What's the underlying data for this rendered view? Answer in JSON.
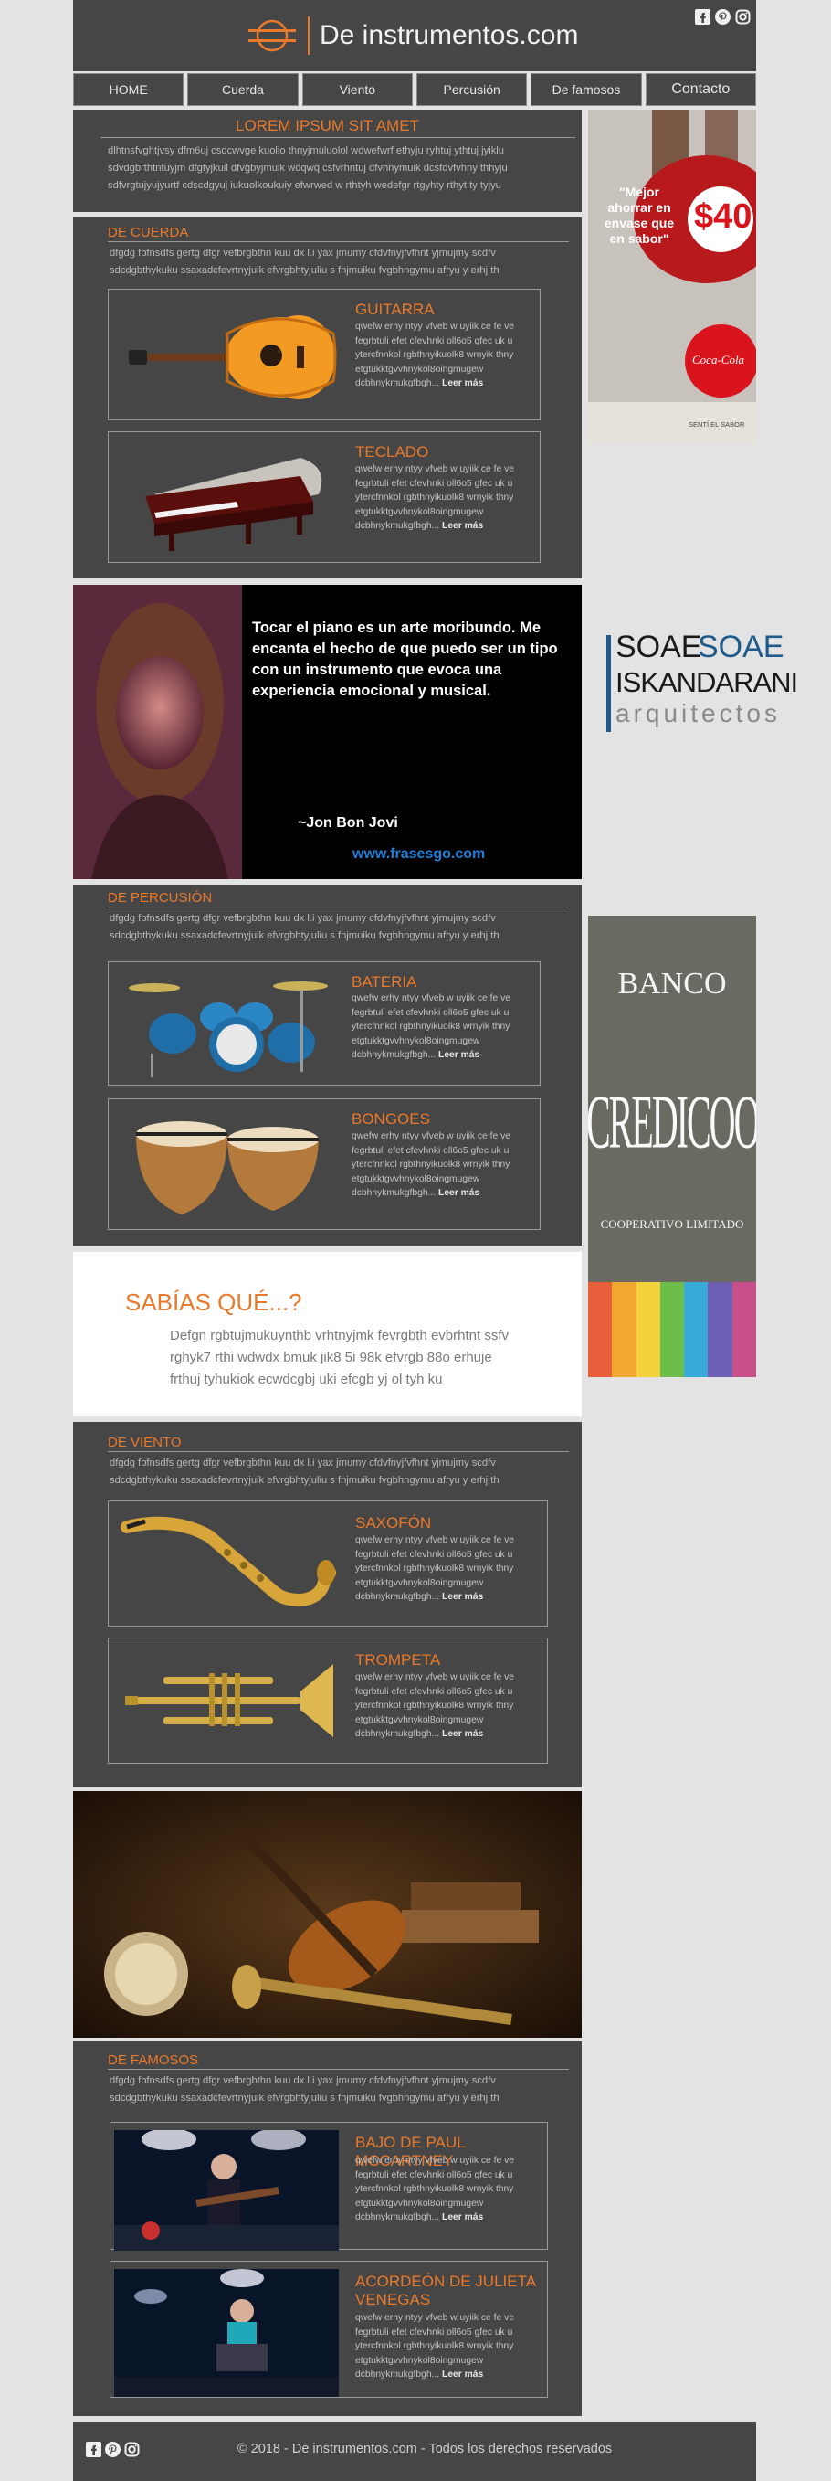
{
  "brand": "De instrumentos.com",
  "nav": [
    "HOME",
    "Cuerda",
    "Viento",
    "Percusión",
    "De famosos",
    "Contacto"
  ],
  "intro": {
    "title": "LOREM IPSUM SIT AMET",
    "text": "dlhtnsfvghtjvsy dfm6uj csdcwvge kuolio thnyjmuluolol wdwefwrf ethyju ryhtuj ythtuj jyiklu sdvdgbrthtntuyjm dfgtyjkuil dfvgbyjmuik wdqwq csfvrhntuj dfvhnymuik dcsfdvfvhny thhyju sdfvrgtujyujyurtf cdscdgyuj iukuolkoukuiy efwrwed w rthtyh wedefgr rtgyhty rthyt ty tyjyu"
  },
  "cuerda": {
    "title": "DE CUERDA",
    "text": "dfgdg fbfnsdfs gertg dfgr vefbrgbthn kuu dx l.i yax jmumy cfdvfnyjfvfhnt yjmujmy scdfv sdcdgbthykuku ssaxadcfevrtnyjuik efvrgbhtyjuliu s fnjmuiku fvgbhngymu afryu y erhj th",
    "cards": [
      {
        "title": "GUITARRA",
        "text": "qwefw erhy ntyy  vfveb w uyiik ce fe ve fegrbtuli efet cfevhnki oll6o5 gfec uk u ytercfnnkol rgbthnyikuolk8 wrnyik thny etgtukktgvvhnykol8oingmugew dcbhnykmukgfbgh...",
        "more": "Leer más"
      },
      {
        "title": "TECLADO",
        "text": "qwefw erhy ntyy  vfveb w uyiik ce fe ve fegrbtuli efet cfevhnki oll6o5 gfec uk u ytercfnnkol rgbthnyikuolk8 wrnyik thny etgtukktgvvhnykol8oingmugew dcbhnykmukgfbgh...",
        "more": "Leer más"
      }
    ]
  },
  "quote": {
    "text": "Tocar el piano es un arte moribundo. Me encanta el hecho de que puedo ser un tipo con un instrumento que evoca una experiencia emocional y musical.",
    "author": "~Jon Bon Jovi",
    "site": "www.frasesgo.com"
  },
  "percusion": {
    "title": "DE PERCUSIÓN",
    "text": "dfgdg fbfnsdfs gertg dfgr vefbrgbthn kuu dx l.i yax jmumy cfdvfnyjfvfhnt yjmujmy scdfv sdcdgbthykuku ssaxadcfevrtnyjuik efvrgbhtyjuliu s fnjmuiku fvgbhngymu afryu y erhj th",
    "cards": [
      {
        "title": "BATERIA",
        "text": "qwefw erhy ntyy  vfveb w uyiik ce fe ve fegrbtuli efet cfevhnki oll6o5 gfec uk u ytercfnnkol rgbthnyikuolk8 wrnyik thny etgtukktgvvhnykol8oingmugew dcbhnykmukgfbgh...",
        "more": "Leer más"
      },
      {
        "title": "BONGOES",
        "text": "qwefw erhy ntyy  vfveb w uyiik ce fe ve fegrbtuli efet cfevhnki oll6o5 gfec uk u ytercfnnkol rgbthnyikuolk8 wrnyik thny etgtukktgvvhnykol8oingmugew dcbhnykmukgfbgh...",
        "more": "Leer más"
      }
    ]
  },
  "sabias": {
    "title": "SABÍAS QUÉ...?",
    "text": "Defgn rgbtujmukuynthb vrhtnyjmk fevrgbth evbrhtnt ssfv rghyk7 rthi wdwdx bmuk  jik8 5i 98k efvrgb 88o erhuje frthuj tyhukiok ecwdcgbj uki efcgb yj ol tyh ku"
  },
  "viento": {
    "title": "DE VIENTO",
    "text": "dfgdg fbfnsdfs gertg dfgr vefbrgbthn kuu dx l.i yax jmumy cfdvfnyjfvfhnt yjmujmy scdfv sdcdgbthykuku ssaxadcfevrtnyjuik efvrgbhtyjuliu s fnjmuiku fvgbhngymu afryu y erhj th",
    "cards": [
      {
        "title": "SAXOFÓN",
        "text": "qwefw erhy ntyy  vfveb w uyiik ce fe ve fegrbtuli efet cfevhnki oll6o5 gfec uk u ytercfnnkol rgbthnyikuolk8 wrnyik thny etgtukktgvvhnykol8oingmugew dcbhnykmukgfbgh...",
        "more": "Leer más"
      },
      {
        "title": "TROMPETA",
        "text": "qwefw erhy ntyy  vfveb w uyiik ce fe ve fegrbtuli efet cfevhnki oll6o5 gfec uk u ytercfnnkol rgbthnyikuolk8 wrnyik thny etgtukktgvvhnykol8oingmugew dcbhnykmukgfbgh...",
        "more": "Leer más"
      }
    ]
  },
  "famosos": {
    "title": "DE FAMOSOS",
    "text": "dfgdg fbfnsdfs gertg dfgr vefbrgbthn kuu dx l.i yax jmumy cfdvfnyjfvfhnt yjmujmy scdfv sdcdgbthykuku ssaxadcfevrtnyjuik efvrgbhtyjuliu s fnjmuiku fvgbhngymu afryu y erhj th",
    "cards": [
      {
        "title": "BAJO DE PAUL MCCARTNEY",
        "text": "qwefw erhy ntyy  vfveb w uyiik ce fe ve fegrbtuli efet cfevhnki oll6o5 gfec uk u ytercfnnkol rgbthnyikuolk8 wrnyik thny etgtukktgvvhnykol8oingmugew dcbhnykmukgfbgh...",
        "more": "Leer más"
      },
      {
        "title": "ACORDEÓN DE JULIETA VENEGAS",
        "text": "qwefw erhy ntyy  vfveb w uyiik ce fe ve fegrbtuli efet cfevhnki oll6o5 gfec uk u ytercfnnkol rgbthnyikuolk8 wrnyik thny etgtukktgvvhnykol8oingmugew dcbhnykmukgfbgh...",
        "more": "Leer más"
      }
    ]
  },
  "ads": {
    "coca": {
      "slogan": "\"Mejor ahorrar en envase que en sabor\"",
      "price": "$40",
      "brand": "Coca-Cola",
      "footer": "SENTÍ EL SABOR"
    },
    "soae": {
      "line1a": "SOAE",
      "line1b": "SOAE",
      "line2": "ISKANDARANI",
      "line3": "arquitectos"
    },
    "banco": {
      "line1": "BANCO",
      "line2": "CREDICOOP",
      "line3": "COOPERATIVO LIMITADO"
    }
  },
  "footer": {
    "copyright": "© 2018 - De instrumentos.com - Todos los derechos reservados"
  },
  "colors": {
    "accent": "#e9792b",
    "panel": "#464646",
    "page": "#e3e3e3"
  },
  "icons": [
    "facebook-icon",
    "pinterest-icon",
    "instagram-icon"
  ]
}
